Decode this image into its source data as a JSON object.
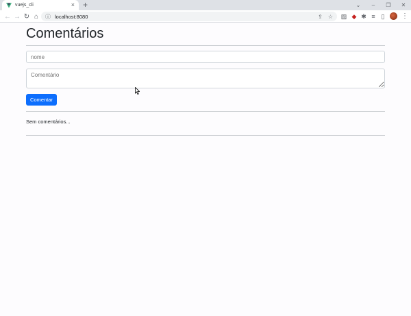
{
  "browser": {
    "tab_title": "vuejs_cli",
    "tab_close": "×",
    "new_tab": "+",
    "url": "localhost:8080",
    "icons": [
      "vue-favicon",
      "back-arrow",
      "forward-arrow",
      "reload",
      "home",
      "info",
      "share",
      "star",
      "extensions",
      "sidebar",
      "profile",
      "menu"
    ]
  },
  "page": {
    "title": "Comentários",
    "name_placeholder": "nome",
    "comment_placeholder": "Comentário",
    "submit_label": "Comentar",
    "empty_message": "Sem comentários..."
  },
  "colors": {
    "primary_button": "#0d6efd",
    "page_background": "#fdfcfe",
    "tab_strip": "#dee1e6"
  }
}
